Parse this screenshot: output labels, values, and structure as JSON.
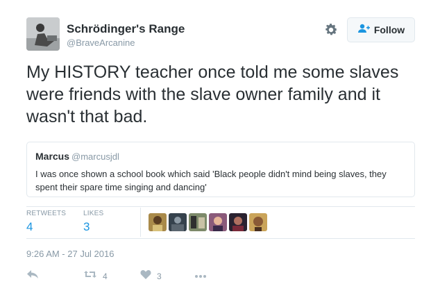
{
  "author": {
    "name": "Schrödinger's Range",
    "handle": "@BraveArcanine"
  },
  "header": {
    "follow_label": "Follow",
    "settings_icon": "gear-icon",
    "follow_icon": "add-user-icon"
  },
  "tweet": {
    "text": "My HISTORY teacher once told me some slaves were friends with the slave owner family and it wasn't that bad."
  },
  "quote": {
    "name": "Marcus",
    "handle": "@marcusjdl",
    "text": "I was once shown a school book which said 'Black people didn't mind being slaves, they spent their spare time singing and dancing'"
  },
  "stats": {
    "retweets_label": "RETWEETS",
    "retweets_value": "4",
    "likes_label": "LIKES",
    "likes_value": "3"
  },
  "timestamp": "9:26 AM - 27 Jul 2016",
  "actions": {
    "reply_icon": "reply-icon",
    "retweet_icon": "retweet-icon",
    "retweet_count": "4",
    "like_icon": "heart-icon",
    "like_count": "3",
    "more_icon": "more-icon"
  },
  "colors": {
    "accent": "#1b95e0",
    "muted": "#8899a6",
    "text": "#292f33",
    "border": "#e1e8ed"
  }
}
